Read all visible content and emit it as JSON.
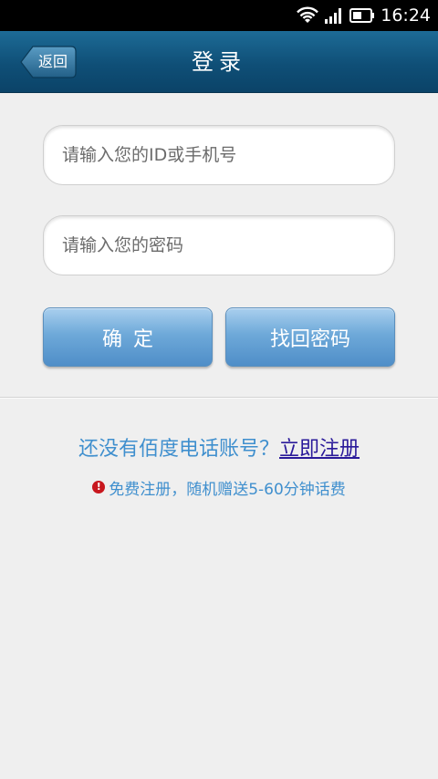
{
  "status_bar": {
    "time": "16:24",
    "icons": [
      "wifi-icon",
      "signal-icon",
      "battery-icon"
    ]
  },
  "title_bar": {
    "back_label": "返回",
    "title": "登录"
  },
  "form": {
    "id_placeholder": "请输入您的ID或手机号",
    "password_placeholder": "请输入您的密码",
    "confirm_label": "确定",
    "find_password_label": "找回密码"
  },
  "register": {
    "prompt": "还没有佰度电话账号？",
    "link": "立即注册",
    "notice": "免费注册，随机赠送5-60分钟话费"
  },
  "colors": {
    "title_bar": "#0f4f77",
    "button": "#6ea9d9",
    "link_text": "#3f8fce",
    "register_link": "#2a1a9a",
    "warning": "#c8171e"
  }
}
